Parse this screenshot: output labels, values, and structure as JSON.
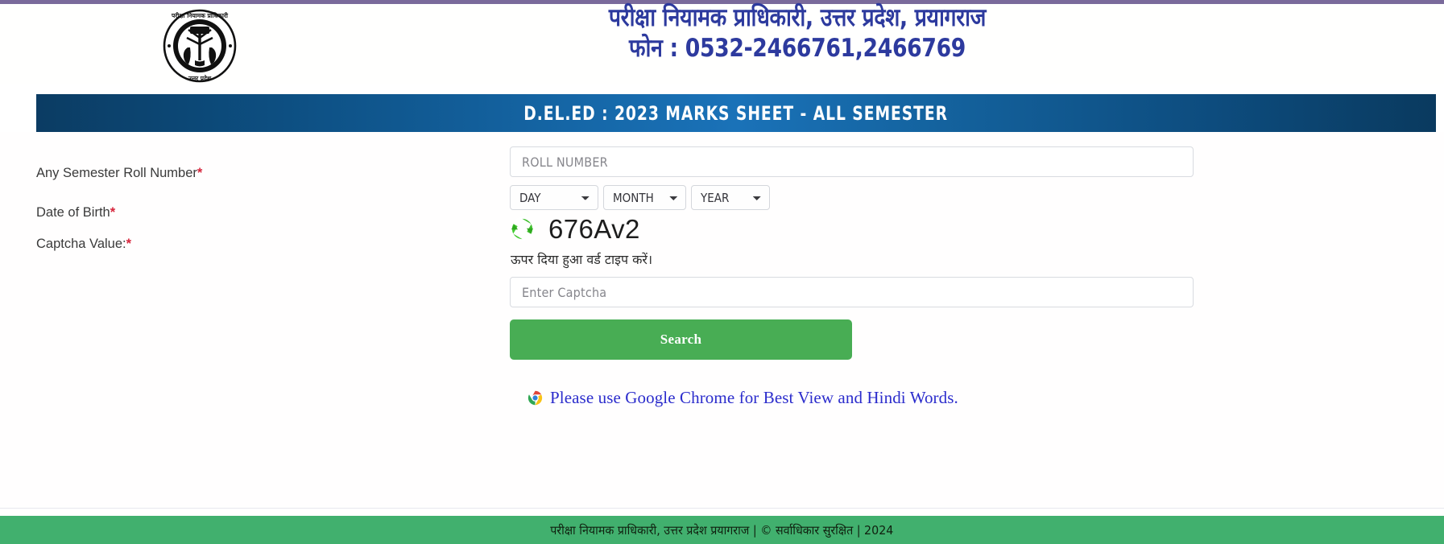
{
  "page": {
    "top_accent_color": "#7a6a9b"
  },
  "header": {
    "logo_name": "up-examination-regulatory-authority-seal",
    "logo_caption_top": "परीक्षा नियामक प्राधिकारी",
    "logo_caption_bottom": "उत्तर प्रदेश",
    "title_line1": "परीक्षा नियामक प्राधिकारी, उत्तर प्रदेश, प्रयागराज",
    "title_line2": "फोन : 0532-2466761,2466769",
    "title_color": "#2d3a9e"
  },
  "banner": {
    "title": "D.EL.ED : 2023 MARKS SHEET - ALL SEMESTER",
    "color_start": "#0b3c63",
    "color_mid": "#1a72b8",
    "color_end": "#0a3a5f"
  },
  "form": {
    "labels": {
      "roll_number": "Any Semester Roll Number",
      "date_of_birth": "Date of Birth",
      "captcha_value": "Captcha Value:",
      "required_marker": "*"
    },
    "roll_number_input": {
      "placeholder": "ROLL NUMBER",
      "value": ""
    },
    "date_of_birth": {
      "day": {
        "selected": "DAY",
        "options": [
          "DAY"
        ]
      },
      "month": {
        "selected": "MONTH",
        "options": [
          "MONTH"
        ]
      },
      "year": {
        "selected": "YEAR",
        "options": [
          "YEAR"
        ]
      }
    },
    "captcha": {
      "refresh_icon": "refresh-icon",
      "code": "676Av2",
      "hint": "ऊपर दिया हुआ वर्ड टाइप करें।",
      "input_placeholder": "Enter Captcha",
      "input_value": ""
    },
    "search_button": {
      "label": "Search",
      "color": "#48ad54"
    }
  },
  "notice": {
    "icon": "chrome-icon",
    "text": "Please use Google Chrome for Best View and Hindi Words.",
    "color": "#2b2ccc"
  },
  "footer": {
    "text": "परीक्षा नियामक प्राधिकारी, उत्तर प्रदेश प्रयागराज | © सर्वाधिकार सुरक्षित | 2024",
    "background_color": "#41b06e"
  }
}
